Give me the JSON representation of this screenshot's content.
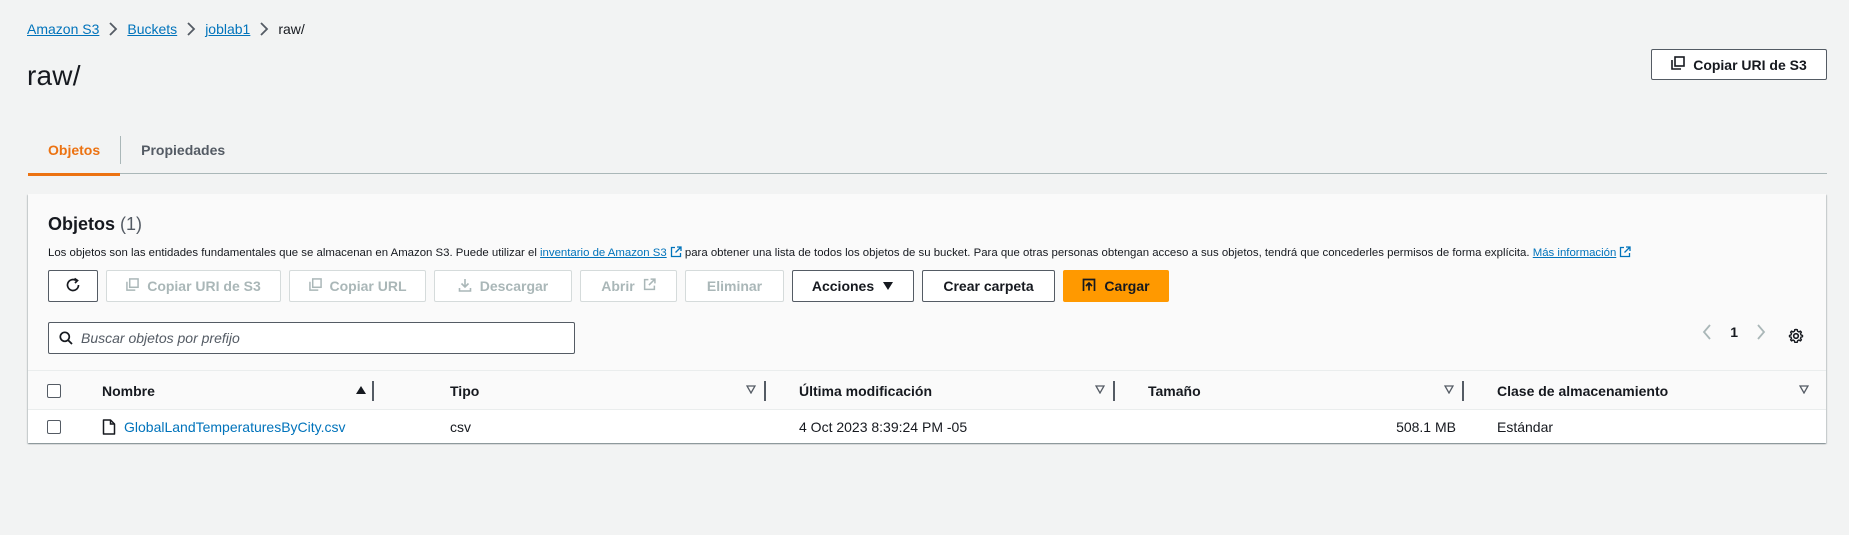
{
  "breadcrumb": {
    "items": [
      "Amazon S3",
      "Buckets",
      "joblab1"
    ],
    "current": "raw/"
  },
  "page": {
    "title": "raw/",
    "copy_uri_label": "Copiar URI de S3"
  },
  "tabs": [
    {
      "label": "Objetos",
      "active": true
    },
    {
      "label": "Propiedades",
      "active": false
    }
  ],
  "objects_panel": {
    "title": "Objetos",
    "count": "(1)",
    "desc_part1": "Los objetos son las entidades fundamentales que se almacenan en Amazon S3. Puede utilizar el",
    "desc_link1": "inventario de Amazon S3",
    "desc_part2": "para obtener una lista de todos los objetos de su bucket. Para que otras personas obtengan acceso a sus objetos, tendrá que concederles permisos de forma explícita.",
    "desc_link2": "Más información"
  },
  "toolbar": {
    "copy_uri": "Copiar URI de S3",
    "copy_url": "Copiar URL",
    "download": "Descargar",
    "open": "Abrir",
    "delete": "Eliminar",
    "actions": "Acciones",
    "create_folder": "Crear carpeta",
    "upload": "Cargar"
  },
  "search": {
    "placeholder": "Buscar objetos por prefijo",
    "value": ""
  },
  "pagination": {
    "page": "1"
  },
  "table": {
    "columns": [
      "Nombre",
      "Tipo",
      "Última modificación",
      "Tamaño",
      "Clase de almacenamiento"
    ],
    "rows": [
      {
        "name": "GlobalLandTemperaturesByCity.csv",
        "type": "csv",
        "modified": "4 Oct 2023 8:39:24 PM -05",
        "size": "508.1 MB",
        "storage_class": "Estándar"
      }
    ]
  },
  "colors": {
    "accent": "#ec7211",
    "primary_button": "#ff9900",
    "link": "#0073bb",
    "background": "#f2f3f3"
  }
}
